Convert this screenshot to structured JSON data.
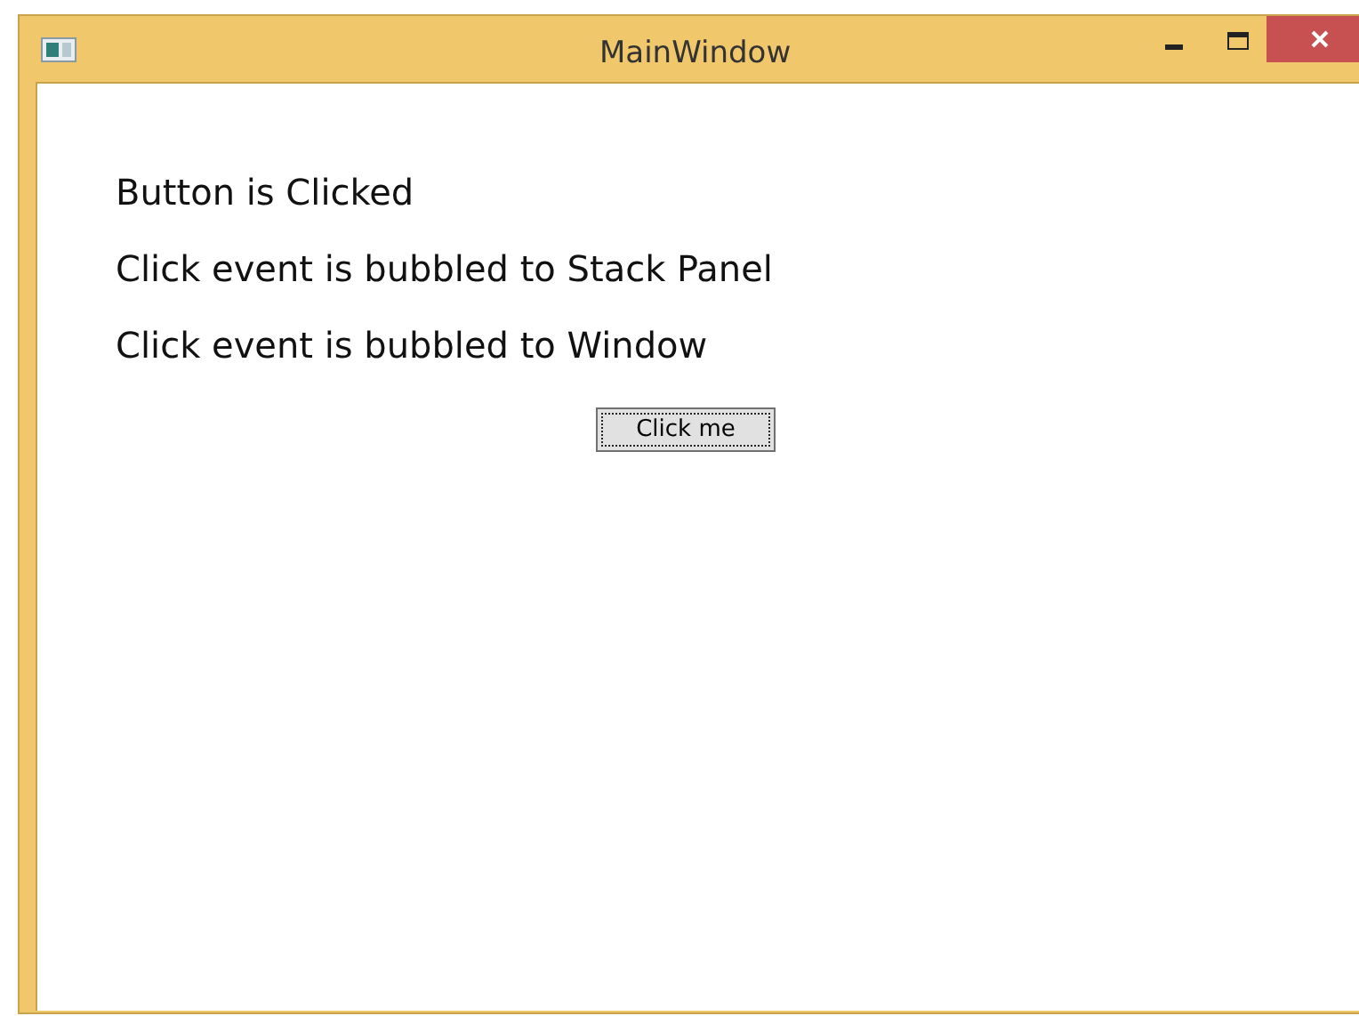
{
  "window": {
    "title": "MainWindow"
  },
  "messages": [
    "Button is Clicked",
    "Click event is bubbled to Stack Panel",
    "Click event is bubbled to Window"
  ],
  "button": {
    "label": "Click me",
    "focused": true
  }
}
